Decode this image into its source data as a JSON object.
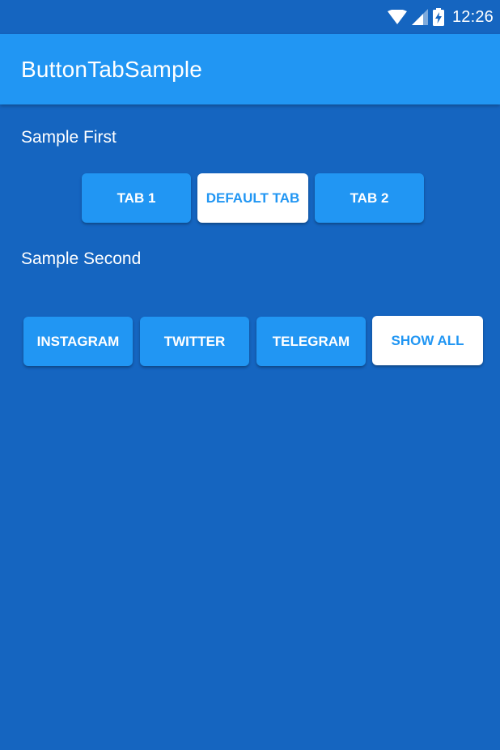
{
  "status_bar": {
    "time": "12:26",
    "icons": [
      "wifi-icon",
      "cell-signal-icon",
      "battery-charging-icon"
    ]
  },
  "app_bar": {
    "title": "ButtonTabSample"
  },
  "section_first": {
    "label": "Sample First",
    "tabs": [
      {
        "label": "TAB 1",
        "selected": false
      },
      {
        "label": "DEFAULT TAB",
        "selected": true
      },
      {
        "label": "TAB 2",
        "selected": false
      }
    ]
  },
  "section_second": {
    "label": "Sample Second",
    "tabs": [
      {
        "label": "INSTAGRAM",
        "selected": false
      },
      {
        "label": "TWITTER",
        "selected": false
      },
      {
        "label": "TELEGRAM",
        "selected": false
      },
      {
        "label": "SHOW ALL",
        "selected": true
      }
    ]
  },
  "colors": {
    "background": "#1565c0",
    "primary": "#2196f3",
    "selected_background": "#ffffff",
    "text_light": "#ffffff"
  }
}
